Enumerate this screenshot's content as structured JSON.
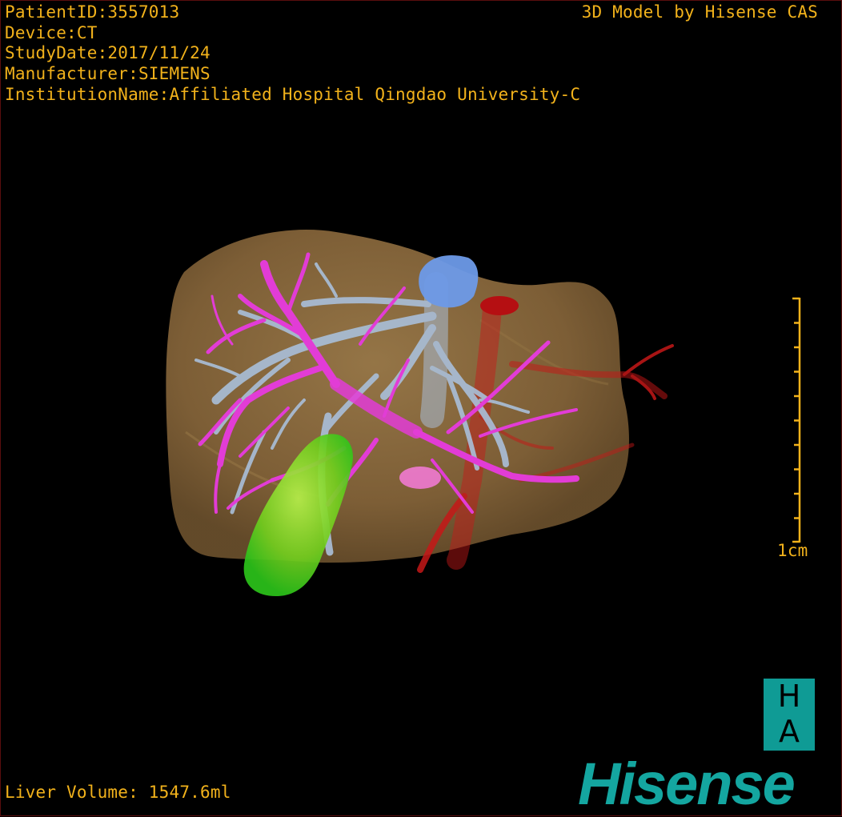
{
  "header": {
    "patient_id": "PatientID:3557013",
    "device": "Device:CT",
    "study_date": "StudyDate:2017/11/24",
    "manufacturer": "Manufacturer:SIEMENS",
    "institution": "InstitutionName:Affiliated Hospital Qingdao University-C",
    "credit": "3D Model by Hisense CAS"
  },
  "footer": {
    "liver_volume": "Liver Volume: 1547.6ml"
  },
  "scale_bar": {
    "label": "1cm"
  },
  "logo": {
    "ha_top": "H",
    "ha_bottom": "A",
    "brand": "Hisense"
  },
  "colors": {
    "text_overlay": "#f2b21b",
    "liver": "#8a6a3c",
    "hepatic_vein": "#a9bdd6",
    "portal_vein": "#e23cd6",
    "artery": "#c61818",
    "gallbladder": "#7ed321",
    "brand": "#14a6a0"
  }
}
